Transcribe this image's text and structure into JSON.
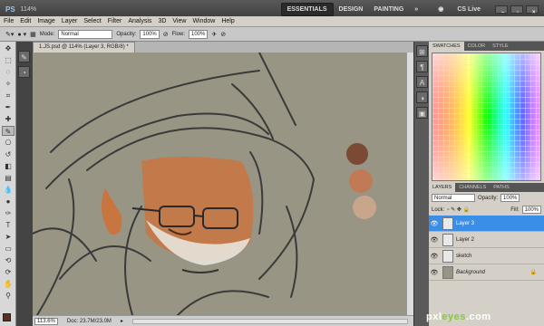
{
  "app": {
    "logo": "PS",
    "zoom": "114%"
  },
  "workspaces": [
    "ESSENTIALS",
    "DESIGN",
    "PAINTING",
    "»"
  ],
  "cslive": "CS Live",
  "menu": [
    "File",
    "Edit",
    "Image",
    "Layer",
    "Select",
    "Filter",
    "Analysis",
    "3D",
    "View",
    "Window",
    "Help"
  ],
  "options": {
    "mode_label": "Mode:",
    "mode_value": "Normal",
    "opacity_label": "Opacity:",
    "opacity_value": "100%",
    "flow_label": "Flow:",
    "flow_value": "100%"
  },
  "document": {
    "tab_title": "1.JS.psd @ 114% (Layer 3, RGB/8) *",
    "status_zoom": "113.6%",
    "status_doc": "Doc: 23.7M/23.0M"
  },
  "panels": {
    "top_tabs": [
      "SWATCHES",
      "COLOR",
      "STYLE"
    ],
    "layer_tabs": [
      "LAYERS",
      "CHANNELS",
      "PATHS"
    ],
    "blend_mode": "Normal",
    "opacity_label": "Opacity:",
    "opacity_value": "100%",
    "lock_label": "Lock:",
    "fill_label": "Fill:",
    "fill_value": "100%",
    "layers": [
      {
        "name": "Layer 3",
        "selected": true
      },
      {
        "name": "Layer 2",
        "selected": false
      },
      {
        "name": "sketch",
        "selected": false
      },
      {
        "name": "Background",
        "selected": false
      }
    ]
  },
  "colors": {
    "foreground": "#5c2f22",
    "canvas": "#999585",
    "accent": "#3a8ee6"
  },
  "canvas_swatches": [
    "#7a4a34",
    "#c07a55",
    "#c9a58c"
  ],
  "footer": {
    "main": "pxl",
    "accent": "eyes",
    "tail": ".com"
  }
}
